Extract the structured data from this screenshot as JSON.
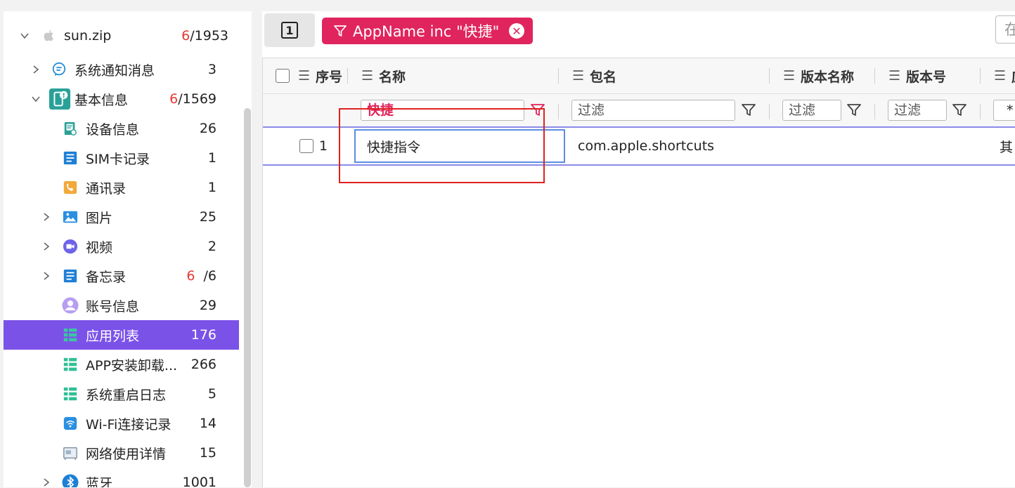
{
  "sidebar": {
    "root": {
      "label": "sun.zip",
      "count_red": "6",
      "count_total": "/1953"
    },
    "items": [
      {
        "label": "系统通知消息",
        "count": "3"
      },
      {
        "label": "基本信息",
        "count_red": "6",
        "count_total": "/1569"
      },
      {
        "label": "设备信息",
        "count": "26"
      },
      {
        "label": "SIM卡记录",
        "count": "1"
      },
      {
        "label": "通讯录",
        "count": "1"
      },
      {
        "label": "图片",
        "count": "25"
      },
      {
        "label": "视频",
        "count": "2"
      },
      {
        "label": "备忘录",
        "count_red": "6",
        "count_total": "/6"
      },
      {
        "label": "账号信息",
        "count": "29"
      },
      {
        "label": "应用列表",
        "count": "176"
      },
      {
        "label": "APP安装卸载...",
        "count": "266"
      },
      {
        "label": "系统重启日志",
        "count": "5"
      },
      {
        "label": "Wi-Fi连接记录",
        "count": "14"
      },
      {
        "label": "网络使用详情",
        "count": "15"
      },
      {
        "label": "蓝牙",
        "count": "1001"
      }
    ]
  },
  "toolbar": {
    "tab_number": "1",
    "filter_chip_label": "AppName inc \"快捷\"",
    "close_glyph": "✕",
    "right_button_text": "在"
  },
  "grid": {
    "columns": [
      "序号",
      "名称",
      "包名",
      "版本名称",
      "版本号",
      "应"
    ],
    "filters": {
      "name": "快捷",
      "package": "过滤",
      "version_name": "过滤",
      "version_code": "过滤",
      "next": "*"
    },
    "rows": [
      {
        "index": "1",
        "name": "快捷指令",
        "package": "com.apple.shortcuts",
        "extra": "其"
      }
    ]
  },
  "colors": {
    "accent": "#7b52e8",
    "filter_chip": "#e0245e",
    "highlight": "#e02020",
    "count_red": "#e53935"
  }
}
